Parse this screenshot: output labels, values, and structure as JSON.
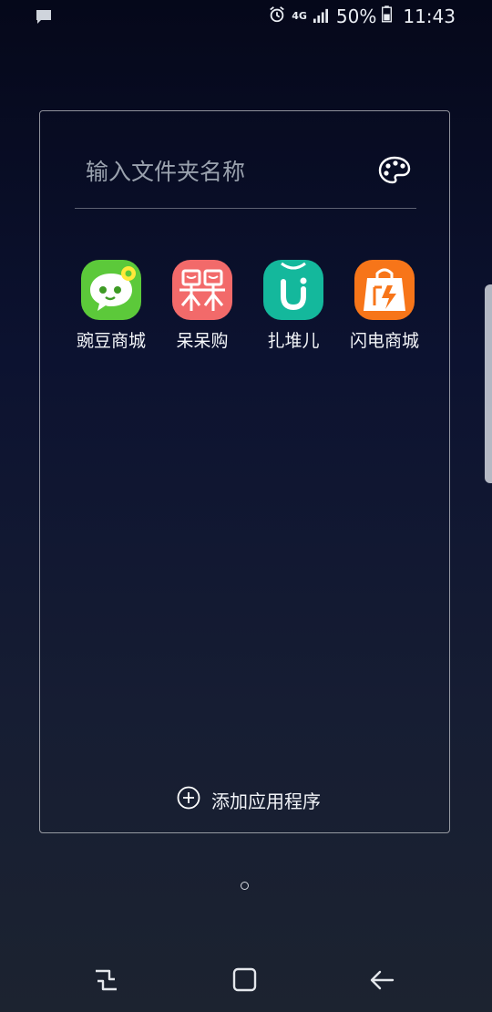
{
  "status_bar": {
    "network": "4G",
    "battery": "50%",
    "time": "11:43"
  },
  "folder": {
    "name_placeholder": "输入文件夹名称",
    "apps": [
      {
        "label": "豌豆商城",
        "icon": "wandou-mall-icon",
        "color": "#5cc93a"
      },
      {
        "label": "呆呆购",
        "icon": "daidai-gou-icon",
        "color": "#f26a6a"
      },
      {
        "label": "扎堆儿",
        "icon": "zhadui-icon",
        "color": "#14b89c"
      },
      {
        "label": "闪电商城",
        "icon": "shandian-mall-icon",
        "color": "#f77519"
      }
    ],
    "add_apps_label": "添加应用程序"
  }
}
